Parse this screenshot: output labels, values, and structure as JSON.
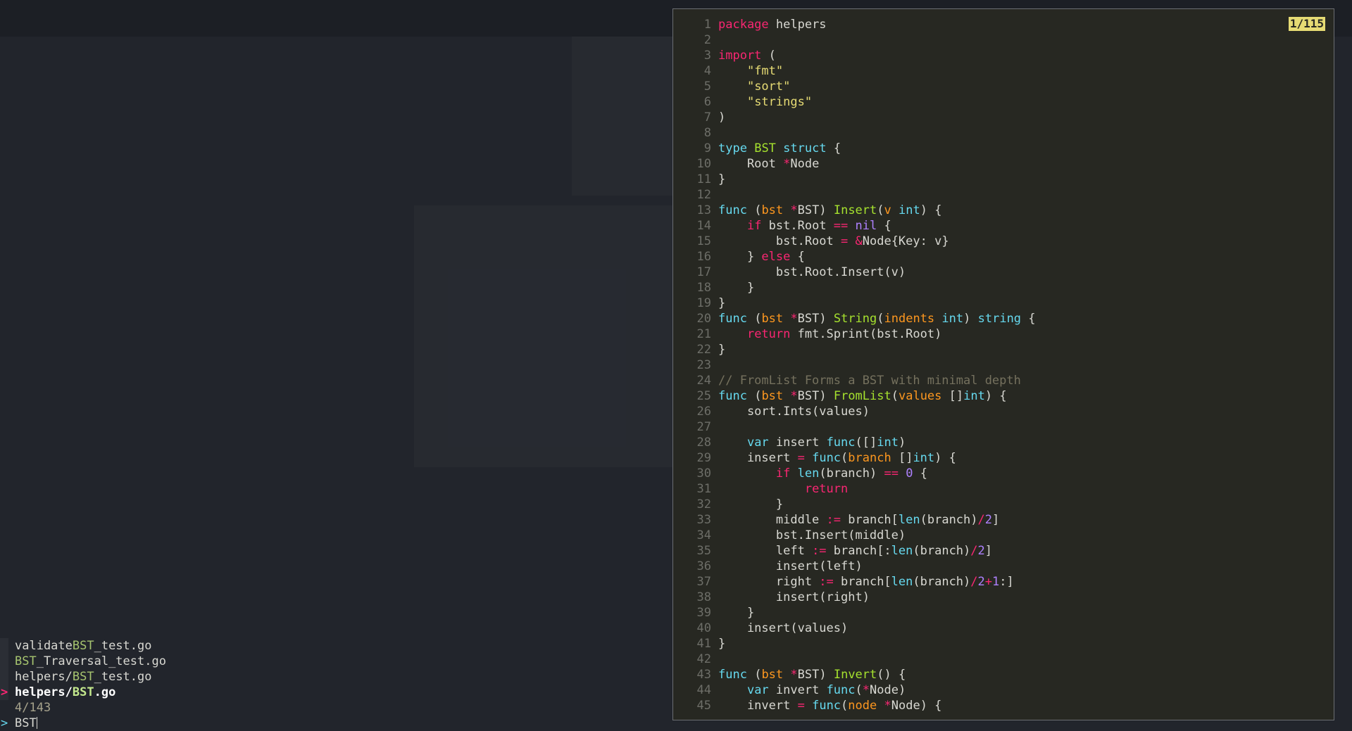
{
  "fzf": {
    "results": [
      {
        "pre": "validate",
        "match": "BST",
        "post": "_test.go",
        "selected": false
      },
      {
        "pre": "",
        "match": "BST",
        "post": "_Traversal_test.go",
        "selected": false
      },
      {
        "pre": "helpers/",
        "match": "BST",
        "post": "_test.go",
        "selected": false
      },
      {
        "pre": "helpers/",
        "match": "BST",
        "post": ".go",
        "selected": true
      }
    ],
    "pointer": ">",
    "count": "4/143",
    "prompt": ">",
    "query": "BST"
  },
  "preview": {
    "counter": "1/115",
    "lines": [
      [
        "1",
        "package helpers"
      ],
      [
        "2",
        ""
      ],
      [
        "3",
        "import ("
      ],
      [
        "4",
        "    \"fmt\""
      ],
      [
        "5",
        "    \"sort\""
      ],
      [
        "6",
        "    \"strings\""
      ],
      [
        "7",
        ")"
      ],
      [
        "8",
        ""
      ],
      [
        "9",
        "type BST struct {"
      ],
      [
        "10",
        "    Root *Node"
      ],
      [
        "11",
        "}"
      ],
      [
        "12",
        ""
      ],
      [
        "13",
        "func (bst *BST) Insert(v int) {"
      ],
      [
        "14",
        "    if bst.Root == nil {"
      ],
      [
        "15",
        "        bst.Root = &Node{Key: v}"
      ],
      [
        "16",
        "    } else {"
      ],
      [
        "17",
        "        bst.Root.Insert(v)"
      ],
      [
        "18",
        "    }"
      ],
      [
        "19",
        "}"
      ],
      [
        "20",
        "func (bst *BST) String(indents int) string {"
      ],
      [
        "21",
        "    return fmt.Sprint(bst.Root)"
      ],
      [
        "22",
        "}"
      ],
      [
        "23",
        ""
      ],
      [
        "24",
        "// FromList Forms a BST with minimal depth"
      ],
      [
        "25",
        "func (bst *BST) FromList(values []int) {"
      ],
      [
        "26",
        "    sort.Ints(values)"
      ],
      [
        "27",
        ""
      ],
      [
        "28",
        "    var insert func([]int)"
      ],
      [
        "29",
        "    insert = func(branch []int) {"
      ],
      [
        "30",
        "        if len(branch) == 0 {"
      ],
      [
        "31",
        "            return"
      ],
      [
        "32",
        "        }"
      ],
      [
        "33",
        "        middle := branch[len(branch)/2]"
      ],
      [
        "34",
        "        bst.Insert(middle)"
      ],
      [
        "35",
        "        left := branch[:len(branch)/2]"
      ],
      [
        "36",
        "        insert(left)"
      ],
      [
        "37",
        "        right := branch[len(branch)/2+1:]"
      ],
      [
        "38",
        "        insert(right)"
      ],
      [
        "39",
        "    }"
      ],
      [
        "40",
        "    insert(values)"
      ],
      [
        "41",
        "}"
      ],
      [
        "42",
        ""
      ],
      [
        "43",
        "func (bst *BST) Invert() {"
      ],
      [
        "44",
        "    var invert func(*Node)"
      ],
      [
        "45",
        "    invert = func(node *Node) {"
      ]
    ]
  },
  "colors": {
    "match": "#a6c46f",
    "pointer": "#f92672",
    "counter_bg": "#e6db74",
    "keyword": "#f92672",
    "type": "#66d9ef",
    "function": "#a6e22e",
    "string": "#e6db74",
    "param": "#fd971f",
    "number": "#ae81ff",
    "comment": "#75715e"
  }
}
